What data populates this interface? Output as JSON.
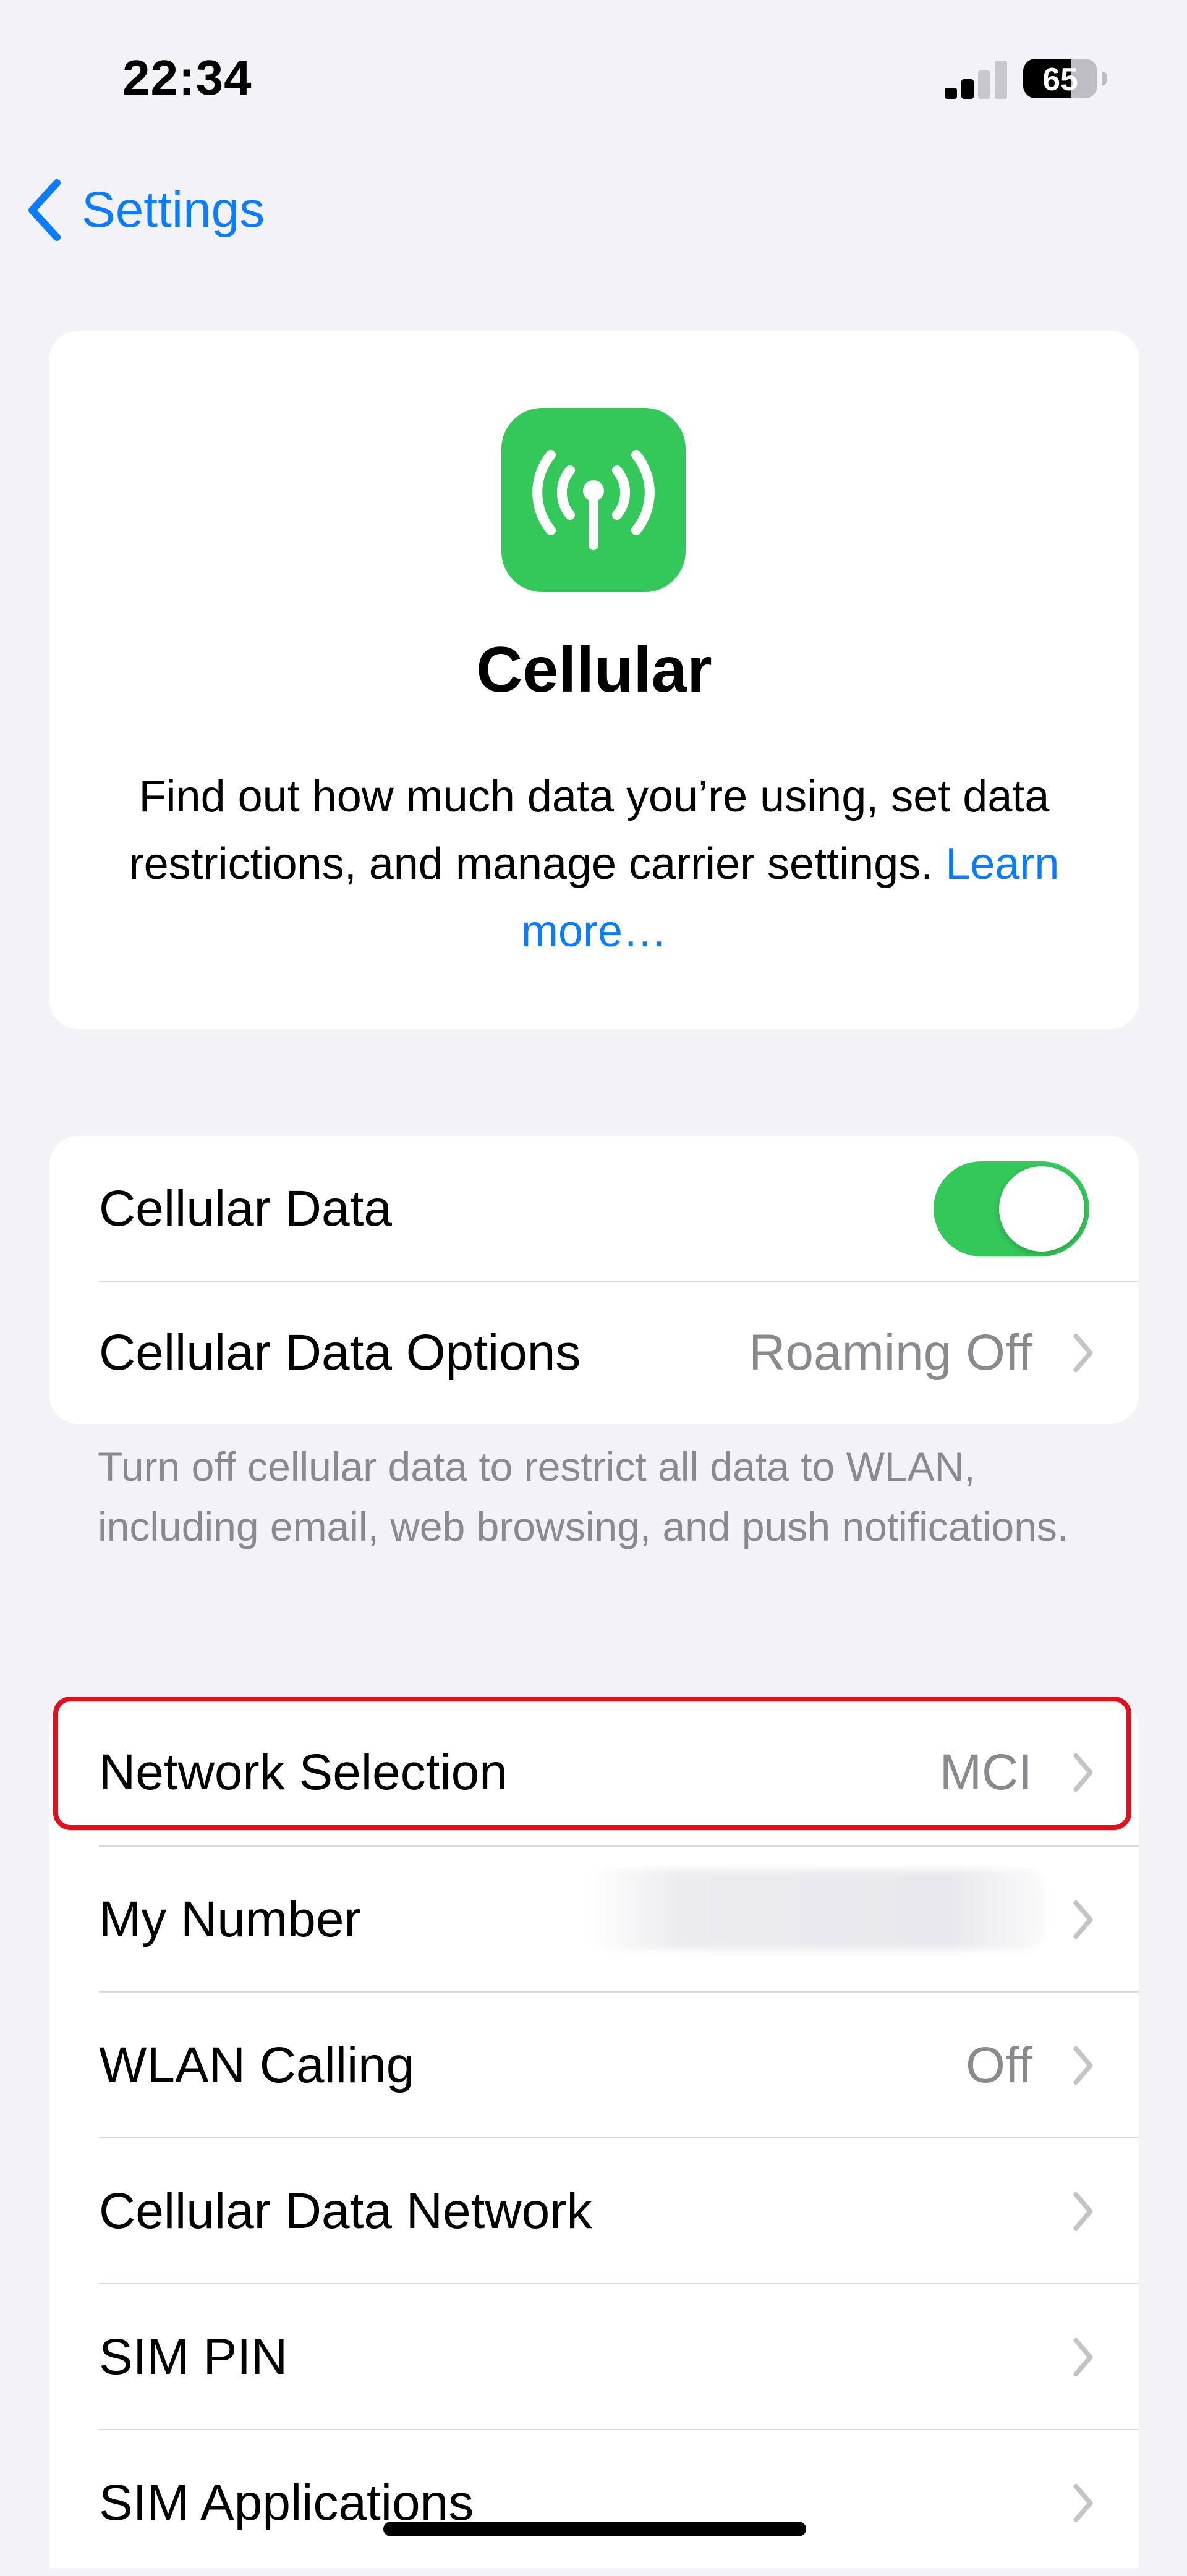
{
  "status_bar": {
    "time": "22:34",
    "battery_level": "65",
    "battery_fill_fraction": 0.65,
    "signal_bars_total": 4,
    "signal_bars_active": 2
  },
  "nav": {
    "back_label": "Settings",
    "back_icon": "chevron-left-icon"
  },
  "hero": {
    "icon": "antenna-icon",
    "title": "Cellular",
    "description": "Find out how much data you’re using, set data restrictions, and manage carrier settings.",
    "link_text": "Learn more…"
  },
  "cellular_section": {
    "rows": [
      {
        "label": "Cellular Data",
        "value": "",
        "control": "toggle",
        "toggle_on": true
      },
      {
        "label": "Cellular Data Options",
        "value": "Roaming Off",
        "control": "chevron"
      }
    ],
    "footer": "Turn off cellular data to restrict all data to WLAN, including email, web browsing, and push notifications."
  },
  "network_section": {
    "rows": [
      {
        "label": "Network Selection",
        "value": "MCI",
        "highlighted": true
      },
      {
        "label": "My Number",
        "value": "",
        "redacted": true
      },
      {
        "label": "WLAN Calling",
        "value": "Off"
      },
      {
        "label": "Cellular Data Network",
        "value": ""
      },
      {
        "label": "SIM PIN",
        "value": ""
      },
      {
        "label": "SIM Applications",
        "value": ""
      }
    ]
  },
  "colors": {
    "accent": "#0a7cff",
    "toggle_on": "#34c759",
    "app_icon": "#34c759",
    "highlight_border": "#e0101e",
    "background": "#f2f2f7"
  }
}
